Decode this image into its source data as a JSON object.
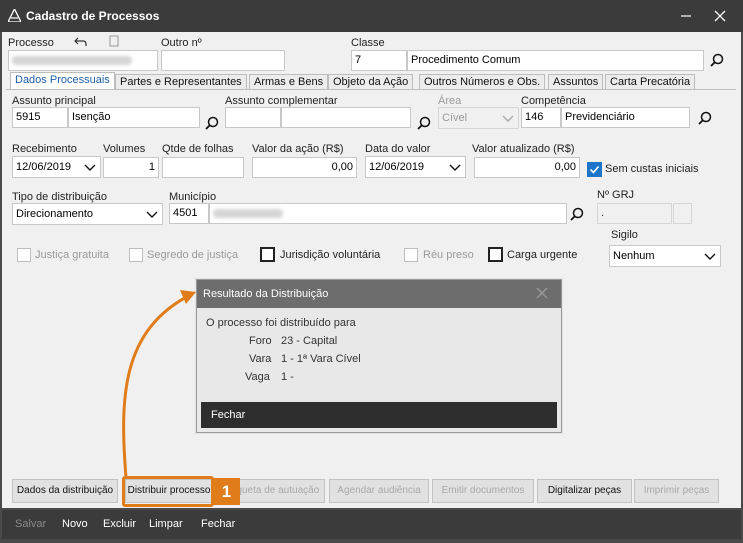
{
  "window": {
    "title": "Cadastro de Processos"
  },
  "header": {
    "processo_label": "Processo",
    "outro_label": "Outro nº",
    "classe_label": "Classe",
    "classe_code": "7",
    "classe_name": "Procedimento Comum"
  },
  "tabs": [
    {
      "label": "Dados Processuais",
      "active": true
    },
    {
      "label": "Partes e Representantes"
    },
    {
      "label": "Armas e Bens"
    },
    {
      "label": "Objeto da Ação"
    },
    {
      "label": "Outros Números e Obs."
    },
    {
      "label": "Assuntos"
    },
    {
      "label": "Carta Precatória"
    }
  ],
  "fields": {
    "assunto_principal_label": "Assunto principal",
    "assunto_principal_code": "5915",
    "assunto_principal_name": "Isenção",
    "assunto_complementar_label": "Assunto complementar",
    "area_label": "Área",
    "area_value": "Cível",
    "competencia_label": "Competência",
    "competencia_code": "146",
    "competencia_name": "Previdenciário",
    "recebimento_label": "Recebimento",
    "recebimento_value": "12/06/2019",
    "volumes_label": "Volumes",
    "volumes_value": "1",
    "qtde_folhas_label": "Qtde de folhas",
    "valor_acao_label": "Valor da ação (R$)",
    "valor_acao_value": "0,00",
    "data_valor_label": "Data do valor",
    "data_valor_value": "12/06/2019",
    "valor_atualizado_label": "Valor atualizado (R$)",
    "valor_atualizado_value": "0,00",
    "sem_custas_label": "Sem custas iniciais",
    "tipo_distribuicao_label": "Tipo de distribuição",
    "tipo_distribuicao_value": "Direcionamento",
    "municipio_label": "Município",
    "municipio_code": "4501",
    "grj_label": "Nº GRJ",
    "grj_value": ".",
    "sigilo_label": "Sigilo",
    "sigilo_value": "Nenhum"
  },
  "checks": {
    "justica_gratuita": "Justiça gratuita",
    "segredo_justica": "Segredo de justiça",
    "jurisdicao_voluntaria": "Jurisdição voluntária",
    "reu_preso": "Réu preso",
    "carga_urgente": "Carga urgente"
  },
  "modal": {
    "title": "Resultado da Distribuição",
    "message": "O processo foi distribuído para",
    "foro_label": "Foro",
    "foro_value": "23 - Capital",
    "vara_label": "Vara",
    "vara_value": "1 - 1ª Vara Cível",
    "vaga_label": "Vaga",
    "vaga_value": "1 -",
    "close_button": "Fechar"
  },
  "bottom_buttons": [
    {
      "label": "Dados da distribuição"
    },
    {
      "label": "Distribuir processo"
    },
    {
      "label": "Etiqueta de autuação"
    },
    {
      "label": "Agendar audiência"
    },
    {
      "label": "Emitir documentos"
    },
    {
      "label": "Digitalizar peças"
    },
    {
      "label": "Imprimir peças"
    }
  ],
  "toolbar": {
    "salvar": "Salvar",
    "novo": "Novo",
    "excluir": "Excluir",
    "limpar": "Limpar",
    "fechar": "Fechar"
  },
  "annotation": {
    "step_number": "1",
    "accent_color": "#e07d1a"
  }
}
